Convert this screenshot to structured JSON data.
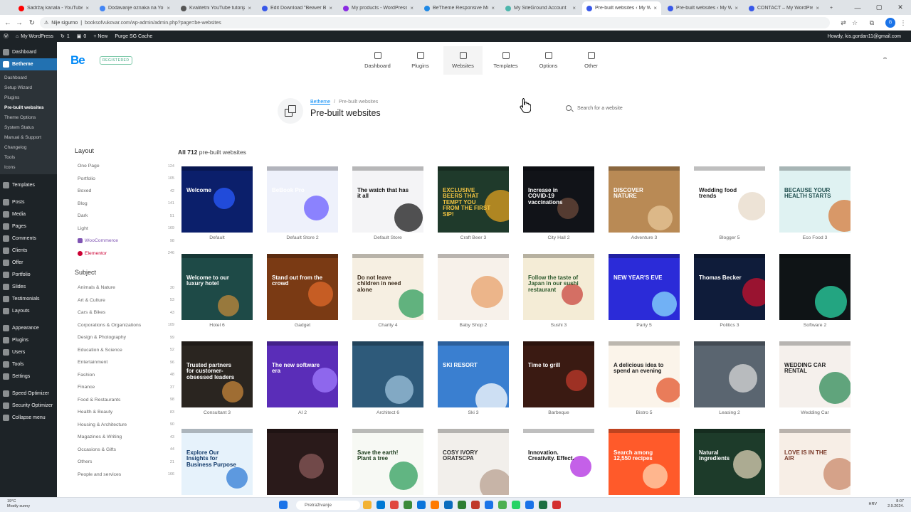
{
  "browser": {
    "tabs": [
      {
        "label": "Sadržaj kanala - YouTube Studio",
        "color": "#ff0000"
      },
      {
        "label": "Dodavanje oznaka na YouTube",
        "color": "#4285f4"
      },
      {
        "label": "Kvalitetni YouTube tutorijala",
        "color": "#555555"
      },
      {
        "label": "Edit Download \"Beaver Builder\"",
        "color": "#3858e9"
      },
      {
        "label": "My products - WordPress IT",
        "color": "#8a2be2"
      },
      {
        "label": "BeTheme Responsive Multi-Purpose",
        "color": "#1e88e5"
      },
      {
        "label": "My SiteGround Account",
        "color": "#4db6ac"
      },
      {
        "label": "Pre-built websites ‹ My WordPress",
        "color": "#3858e9"
      },
      {
        "label": "Pre-built websites ‹ My WordPress",
        "color": "#3858e9"
      },
      {
        "label": "CONTACT – My WordPress",
        "color": "#3858e9"
      }
    ],
    "active_tab": 7,
    "security_label": "Nije sigurno",
    "url": "booksofvukovar.com/wp-admin/admin.php?page=be-websites",
    "window_controls": [
      "—",
      "▢",
      "✕"
    ]
  },
  "adminbar": {
    "site": "My WordPress",
    "updates": "1",
    "comments": "0",
    "new": "+ New",
    "purge": "Purge SG Cache",
    "howdy": "Howdy, kis.gordan11@gmail.com"
  },
  "wp_menu": {
    "dashboard": "Dashboard",
    "betheme": "Betheme",
    "betheme_sub": [
      "Dashboard",
      "Setup Wizard",
      "Plugins",
      "Pre-built websites",
      "Theme Options",
      "System Status",
      "Manual & Support",
      "Changelog",
      "Tools",
      "Icons"
    ],
    "betheme_sub_current": 3,
    "group1": [
      "Templates"
    ],
    "group2": [
      "Posts",
      "Media",
      "Pages",
      "Comments",
      "Clients",
      "Offer",
      "Portfolio",
      "Slides",
      "Testimonials",
      "Layouts"
    ],
    "group3": [
      "Appearance",
      "Plugins",
      "Users",
      "Tools",
      "Settings"
    ],
    "group4": [
      "Speed Optimizer",
      "Security Optimizer",
      "Collapse menu"
    ]
  },
  "be_header": {
    "logo": "Be",
    "registered": "REGISTERED",
    "nav": [
      "Dashboard",
      "Plugins",
      "Websites",
      "Templates",
      "Options",
      "Other"
    ],
    "nav_hover_index": 2
  },
  "breadcrumb": {
    "root": "Betheme",
    "sep": "/",
    "current": "Pre-built websites"
  },
  "page_title": "Pre-built websites",
  "search": {
    "placeholder": "Search for a website"
  },
  "filters": {
    "layout_title": "Layout",
    "layout": [
      {
        "label": "One Page",
        "count": "124"
      },
      {
        "label": "Portfolio",
        "count": "105"
      },
      {
        "label": "Boxed",
        "count": "42"
      },
      {
        "label": "Blog",
        "count": "141"
      },
      {
        "label": "Dark",
        "count": "51"
      },
      {
        "label": "Light",
        "count": "169"
      },
      {
        "label": "WooCommerce",
        "count": "98"
      },
      {
        "label": "Elementor",
        "count": "246"
      }
    ],
    "subject_title": "Subject",
    "subject": [
      {
        "label": "Animals & Nature",
        "count": "30"
      },
      {
        "label": "Art & Culture",
        "count": "53"
      },
      {
        "label": "Cars & Bikes",
        "count": "43"
      },
      {
        "label": "Corporations & Organizations",
        "count": "109"
      },
      {
        "label": "Design & Photography",
        "count": "99"
      },
      {
        "label": "Education & Science",
        "count": "52"
      },
      {
        "label": "Entertainment",
        "count": "96"
      },
      {
        "label": "Fashion",
        "count": "48"
      },
      {
        "label": "Finance",
        "count": "37"
      },
      {
        "label": "Food & Restaurants",
        "count": "98"
      },
      {
        "label": "Health & Beauty",
        "count": "83"
      },
      {
        "label": "Housing & Architecture",
        "count": "90"
      },
      {
        "label": "Magazines & Writing",
        "count": "43"
      },
      {
        "label": "Occasions & Gifts",
        "count": "44"
      },
      {
        "label": "Others",
        "count": "21"
      },
      {
        "label": "People and services",
        "count": "166"
      }
    ]
  },
  "all_count": {
    "number": "All 712",
    "suffix": "pre-built websites"
  },
  "websites": [
    {
      "name": "Default",
      "bg": "#0b1f6b",
      "accent": "#2a5bff",
      "text": "Welcome",
      "tc": "#ffffff"
    },
    {
      "name": "Default Store 2",
      "bg": "#eef1fb",
      "accent": "#6a5cff",
      "text": "BeBook Pro",
      "tc": "#ffffff"
    },
    {
      "name": "Default Store",
      "bg": "#f4f4f6",
      "accent": "#1a1a1a",
      "text": "The watch that has it all",
      "tc": "#111111"
    },
    {
      "name": "Craft Beer 3",
      "bg": "#1f3a2b",
      "accent": "#e0a020",
      "text": "EXCLUSIVE BEERS THAT TEMPT YOU FROM THE FIRST SIP!",
      "tc": "#f4c542"
    },
    {
      "name": "City Hall 2",
      "bg": "#111318",
      "accent": "#6b4a3a",
      "text": "Increase in COVID-19 vaccinations",
      "tc": "#ffffff"
    },
    {
      "name": "Adventure 3",
      "bg": "#b98a55",
      "accent": "#e8c79a",
      "text": "DISCOVER NATURE",
      "tc": "#ffffff"
    },
    {
      "name": "Blogger 5",
      "bg": "#ffffff",
      "accent": "#e7d9c8",
      "text": "Wedding food trends",
      "tc": "#222222"
    },
    {
      "name": "Eco Food 3",
      "bg": "#dff2f2",
      "accent": "#d57a3a",
      "text": "BECAUSE YOUR HEALTH STARTS",
      "tc": "#1e4e4e"
    },
    {
      "name": "Hotel 6",
      "bg": "#1e4a47",
      "accent": "#c28a3a",
      "text": "Welcome to our luxury hotel",
      "tc": "#ffffff"
    },
    {
      "name": "Gadget",
      "bg": "#7a3a14",
      "accent": "#e06a2a",
      "text": "Stand out from the crowd",
      "tc": "#ffffff"
    },
    {
      "name": "Charity 4",
      "bg": "#f6efe2",
      "accent": "#2f9e5c",
      "text": "Do not leave children in need alone",
      "tc": "#3a2a1a"
    },
    {
      "name": "Baby Shop 2",
      "bg": "#f7f1ea",
      "accent": "#e8a06a",
      "text": "",
      "tc": "#333333"
    },
    {
      "name": "Sushi 3",
      "bg": "#f4ecd6",
      "accent": "#c9463d",
      "text": "Follow the taste of Japan in our sushi restaurant",
      "tc": "#2e5a2e"
    },
    {
      "name": "Party 5",
      "bg": "#2b2bd8",
      "accent": "#8adfff",
      "text": "NEW YEAR'S EVE",
      "tc": "#ffffff"
    },
    {
      "name": "Politics 3",
      "bg": "#0f1c3a",
      "accent": "#c8102e",
      "text": "Thomas Becker",
      "tc": "#ffffff"
    },
    {
      "name": "Software 2",
      "bg": "#0f1416",
      "accent": "#2bd6a6",
      "text": "",
      "tc": "#ffffff"
    },
    {
      "name": "Consultant 3",
      "bg": "#2a2520",
      "accent": "#c7863a",
      "text": "Trusted partners for customer-obsessed leaders",
      "tc": "#ffffff"
    },
    {
      "name": "AI 2",
      "bg": "#5a2db8",
      "accent": "#a07bff",
      "text": "The new software era",
      "tc": "#ffffff"
    },
    {
      "name": "Architect 6",
      "bg": "#2e5a7a",
      "accent": "#9fc4de",
      "text": "",
      "tc": "#ffffff"
    },
    {
      "name": "Ski 3",
      "bg": "#3a7fd0",
      "accent": "#ffffff",
      "text": "SKI RESORT",
      "tc": "#ffffff"
    },
    {
      "name": "Barbeque",
      "bg": "#3a1a12",
      "accent": "#c0392b",
      "text": "Time to grill",
      "tc": "#ffffff"
    },
    {
      "name": "Bistro 5",
      "bg": "#fbf4ea",
      "accent": "#e3542a",
      "text": "A delicious idea to spend an evening",
      "tc": "#222222"
    },
    {
      "name": "Leasing 2",
      "bg": "#5a6570",
      "accent": "#d8d8d8",
      "text": "",
      "tc": "#ffffff"
    },
    {
      "name": "Wedding Car",
      "bg": "#f5f0ec",
      "accent": "#2e8b57",
      "text": "WEDDING CAR RENTAL",
      "tc": "#222222"
    },
    {
      "name": "",
      "bg": "#e6f2fb",
      "accent": "#2f7bd6",
      "text": "Explore Our Insights for Business Purpose",
      "tc": "#123a6a"
    },
    {
      "name": "",
      "bg": "#2a1a1a",
      "accent": "#8a5a5a",
      "text": "",
      "tc": "#ffffff"
    },
    {
      "name": "",
      "bg": "#f7f9f4",
      "accent": "#2f9e5c",
      "text": "Save the earth! Plant a tree",
      "tc": "#1a3a1a"
    },
    {
      "name": "",
      "bg": "#f2efeb",
      "accent": "#b8a090",
      "text": "COSY IVORY ORATSCPA",
      "tc": "#333333"
    },
    {
      "name": "",
      "bg": "#ffffff",
      "accent": "#b02be0",
      "text": "Innovation. Creativity. Effect.",
      "tc": "#111111"
    },
    {
      "name": "",
      "bg": "#ff5a2a",
      "accent": "#ffd6b0",
      "text": "Search among 12,550 recipes",
      "tc": "#ffffff"
    },
    {
      "name": "",
      "bg": "#1d3b2a",
      "accent": "#dcd2b5",
      "text": "Natural ingredients",
      "tc": "#ffffff"
    },
    {
      "name": "",
      "bg": "#f7eee6",
      "accent": "#c9886a",
      "text": "LOVE IS IN THE AIR",
      "tc": "#7a3a2a"
    }
  ],
  "taskbar": {
    "weather_temp": "19°C",
    "weather_desc": "Mostly sunny",
    "search": "Pretraživanje",
    "lang": "HRV",
    "time": "8:07",
    "date": "2.9.2024."
  }
}
